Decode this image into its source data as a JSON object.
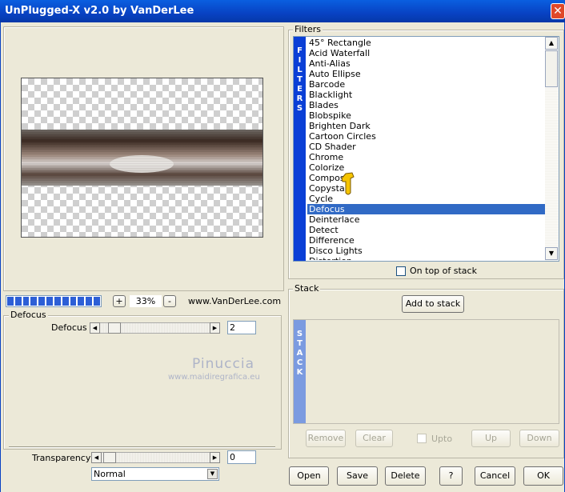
{
  "window": {
    "title": "UnPlugged-X v2.0 by VanDerLee",
    "close_glyph": "✕"
  },
  "preview": {
    "zoom_minus": "-",
    "zoom_plus": "+",
    "zoom_value": "33%",
    "website": "www.VanDerLee.com",
    "progress_segments": 12
  },
  "filters": {
    "group_label": "Filters",
    "side_label": [
      "F",
      "I",
      "L",
      "T",
      "E",
      "R",
      "S"
    ],
    "items": [
      "45° Rectangle",
      "Acid Waterfall",
      "Anti-Alias",
      "Auto Ellipse",
      "Barcode",
      "Blacklight",
      "Blades",
      "Blobspike",
      "Brighten Dark",
      "Cartoon Circles",
      "CD Shader",
      "Chrome",
      "Colorize",
      "Compose",
      "Copystar",
      "Cycle",
      "Defocus",
      "Deinterlace",
      "Detect",
      "Difference",
      "Disco Lights",
      "Distortion"
    ],
    "selected_index": 16,
    "on_top_label": "On top of stack"
  },
  "params": {
    "group_label": "Defocus",
    "defocus_label": "Defocus",
    "defocus_value": "2",
    "transparency_label": "Transparency",
    "transparency_value": "0",
    "blend_mode": "Normal"
  },
  "watermark": {
    "name": "Pinuccia",
    "url": "www.maidiregrafica.eu"
  },
  "stack": {
    "group_label": "Stack",
    "add_button": "Add to stack",
    "side_label": [
      "S",
      "T",
      "A",
      "C",
      "K"
    ],
    "remove_button": "Remove",
    "clear_button": "Clear",
    "upto_label": "Upto",
    "up_button": "Up",
    "down_button": "Down"
  },
  "bottom": {
    "open": "Open",
    "save": "Save",
    "delete": "Delete",
    "help": "?",
    "cancel": "Cancel",
    "ok": "OK"
  },
  "colors": {
    "titlebar": "#0842c3",
    "selection": "#316ac5",
    "side_bar_filters": "#0a3fd6",
    "side_bar_stack": "#7b9be0"
  }
}
